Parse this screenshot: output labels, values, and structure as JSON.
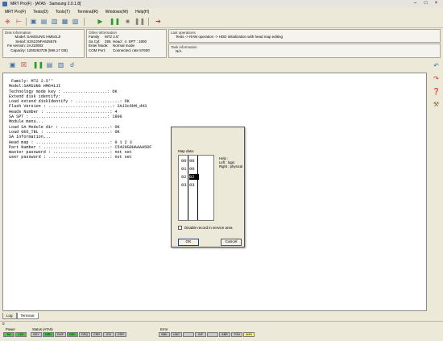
{
  "window": {
    "title": "MRT Pro(F) · [ATA5 · Samsung 2.0.1.8]"
  },
  "menu": [
    "MRT Pro(F)",
    "Tests(D)",
    "Tools(T)",
    "Terminal(R)",
    "Windows(W)",
    "Help(H)"
  ],
  "disk_info": {
    "title": "Disk Information",
    "rows": [
      {
        "label": "Model:",
        "value": "SAMSUNG HM641JI"
      },
      {
        "label": "Serial:",
        "value": "S2S2JNFA625576"
      },
      {
        "label": "Fw version:",
        "value": "2AJ10002"
      },
      {
        "label": "Capacity:",
        "value": "1250263728 (596.17 GB)"
      }
    ]
  },
  "other_info": {
    "title": "Other Information",
    "rows": [
      {
        "label": "Family",
        "value": "MT2 2.5''"
      },
      {
        "label": "Sa Cyl:",
        "value": "255  Head : 4  SPT : 1800"
      },
      {
        "label": "Enter Mode:",
        "value": "Normal mode"
      },
      {
        "label": "COM Port:",
        "value": "Connected, rate 57600"
      }
    ]
  },
  "last_ops": {
    "title": "Last operations",
    "text": "Tests -> RAM operation -> HDD initialization with head map editing"
  },
  "task_info": {
    "title": "Task information",
    "text": "N/A"
  },
  "terminal_lines": [
    " Family: MT2 2.5''",
    "Model:SAMSUNG HM641JI",
    "Technology mode key : ..................: OK",
    "",
    "Extend disk identify:",
    "Load extend diskIdentify : ..................: OK",
    "Flash Version : ..........................: 2AJ3c6bM_d43",
    "Heads Number : ..........................: 4",
    "SA SPT : ...............................: 1800",
    "",
    "Module menu...",
    "Load SA Module dir : ....................: OK",
    "Load GEO_TBL : ..........................: OK",
    "",
    "SA information...",
    "Head map : ..............................: 0 1 2 3",
    "Part Number : ...........................: C5429G9HAAAA50F",
    "master password : .......................: not set",
    "user password : .........................: not set"
  ],
  "tabs": [
    "Log",
    "Terminal"
  ],
  "status_value": "0",
  "status": {
    "power_label": "Power",
    "power_leds": [
      "5V",
      "12V"
    ],
    "status_label": "Status (ATA5)",
    "status_leds": [
      "BSY",
      "DRD",
      "DWF",
      "DSC",
      "DRQ",
      "CRR",
      "IDX",
      "ERR"
    ],
    "error_label": "Error",
    "error_leds": [
      "BBK",
      "UNC",
      "",
      "INF",
      "",
      "ABR",
      "TON",
      "AMN"
    ]
  },
  "dialog": {
    "map_label": "Map data:",
    "rows": [
      {
        "c1": "00",
        "c2": "00"
      },
      {
        "c1": "01",
        "c2": "00"
      },
      {
        "c1": "02",
        "c2": "02"
      },
      {
        "c1": "03",
        "c2": "03"
      }
    ],
    "help_lines": [
      "Help :",
      "Left : logic",
      "Right : physical"
    ],
    "checkbox_label": "Disable record in service area",
    "ok_label": "OK",
    "cancel_label": "Cancel"
  },
  "colors": {
    "green": "#3ecf3e",
    "yellow": "#ffff55"
  }
}
